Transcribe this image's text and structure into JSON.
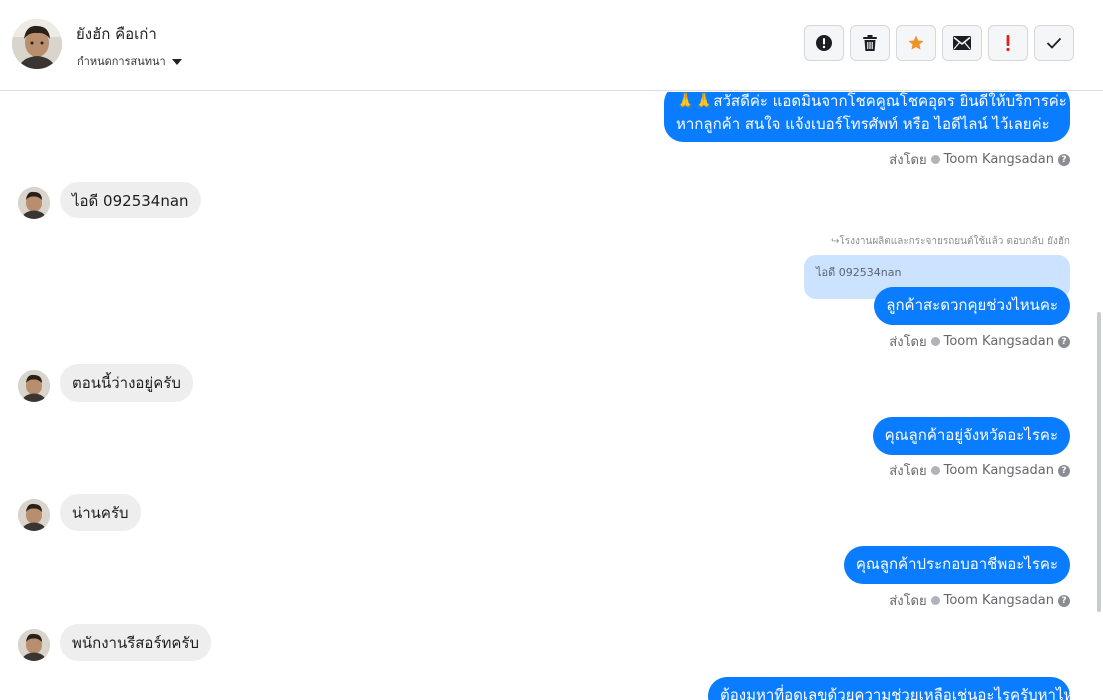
{
  "header": {
    "contact_name": "ยังฮัก คือเก่า",
    "assign_label": "กำหนดการสนทนา",
    "actions": [
      {
        "icon": "alert-circle-icon",
        "name": "report-button"
      },
      {
        "icon": "trash-icon",
        "name": "delete-button"
      },
      {
        "icon": "star-icon",
        "name": "star-button",
        "color": "#f0922b"
      },
      {
        "icon": "envelope-icon",
        "name": "mark-unread-button"
      },
      {
        "icon": "exclamation-icon",
        "name": "spam-button",
        "color": "#e02020"
      },
      {
        "icon": "check-icon",
        "name": "done-button"
      }
    ]
  },
  "messages": {
    "m1_line1": "🙏🙏สวัสดีค่ะ แอดมินจากโชคคูณโชคอุดร ยินดีให้บริการค่ะ",
    "m1_line2": "หากลูกค้า สนใจ แจ้งเบอร์โทรศัพท์ หรือ ไอดีไลน์  ไว้เลยค่ะ",
    "m2": "ไอดี 092534nan",
    "reply_meta": "↪โรงงานผลิตและกระจายรถยนต์ใช้แล้ว ตอบกลับ ยังฮัก",
    "quoted": "ไอดี 092534nan",
    "m3": "ลูกค้าสะดวกคุยช่วงไหนคะ",
    "m4": "ตอนนี้ว่างอยู่ครับ",
    "m5": "คุณลูกค้าอยู่จังหวัดอะไรคะ",
    "m6": "น่านครับ",
    "m7": "คุณลูกค้าประกอบอาชีพอะไรคะ",
    "m8": "พนักงานรีสอร์ทครับ",
    "m9": "ต้องมหาที่อุดเลขด้วยความช่วยเหลือเช่นอะไรครับหาไหมคะ"
  },
  "sent_by": {
    "label": "ส่งโดย",
    "agent": "Toom Kangsadan",
    "help": "?"
  },
  "colors": {
    "outgoing_bubble": "#0a7cff",
    "incoming_bubble": "#eeeeee",
    "quoted_bubble": "#cce3ff"
  }
}
